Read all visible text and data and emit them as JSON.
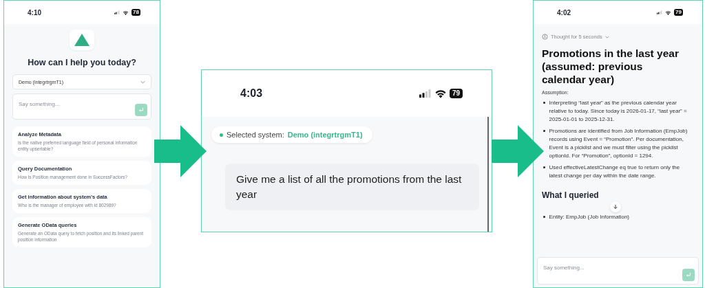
{
  "left_screen": {
    "status_bar": {
      "time": "4:10",
      "battery": "78"
    },
    "title": "How can I help you today?",
    "system_select": {
      "value": "Demo (integrtrgmT1)"
    },
    "message_input": {
      "placeholder": "Say something..."
    },
    "suggestions": [
      {
        "title": "Analyze Metadata",
        "description": "Is the native preferred language field of personal information entity upsertable?"
      },
      {
        "title": "Query Documentation",
        "description": "How is Position management done in SuccessFactors?"
      },
      {
        "title": "Get information about system's data",
        "description": "Who is the manager of employee with id 802989?"
      },
      {
        "title": "Generate OData queries",
        "description": "Generate an OData query to fetch position and its linked parent position information"
      }
    ]
  },
  "middle_screen": {
    "status_bar": {
      "time": "4:03",
      "battery": "79"
    },
    "selected_system": {
      "label": "Selected system:",
      "value": "Demo (integrtrgmT1)"
    },
    "user_message": "Give me a list of all the promotions from the last year"
  },
  "right_screen": {
    "status_bar": {
      "time": "4:02",
      "battery": "79"
    },
    "thought": "Thought for 5 seconds",
    "heading": "Promotions in the last year (assumed: previous calendar year)",
    "assumption_label": "Assumption:",
    "assumptions": [
      "Interpreting “last year” as the previous calendar year relative to today. Since today is 2026-01-17, “last year” = 2025-01-01 to 2025-12-31.",
      "Promotions are identified from Job Information (EmpJob) records using Event = “Promotion”. Per documentation, Event is a picklist and we must filter using the picklist optionId. For “Promotion”, optionId = 1294.",
      "Used effectiveLatestChange eq true to return only the latest change per day within the date range."
    ],
    "section_heading": "What I queried",
    "queried": [
      "Entity: EmpJob (Job Information)"
    ],
    "message_input": {
      "placeholder": "Say something..."
    }
  }
}
